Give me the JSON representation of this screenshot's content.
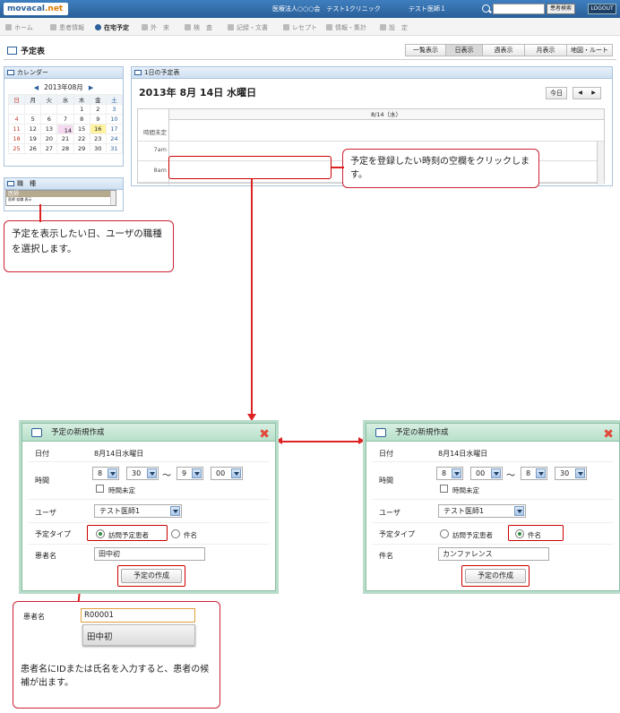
{
  "topbar": {
    "logo_text": "movacal",
    "logo_suffix": ".net",
    "organization": "医療法人○○○会　テスト1クリニック",
    "user": "テスト医師１",
    "search_button": "患者検索",
    "logout": "LOGOUT"
  },
  "nav": {
    "items": [
      {
        "label": "ホーム"
      },
      {
        "label": "患者情報"
      },
      {
        "label": "在宅予定"
      },
      {
        "label": "外　来"
      },
      {
        "label": "検　査"
      },
      {
        "label": "記録・文書"
      },
      {
        "label": "レセプト"
      },
      {
        "label": "情報・集計"
      },
      {
        "label": "設　定"
      }
    ],
    "active_index": 2
  },
  "page": {
    "title": "予定表",
    "view_tabs": [
      "一覧表示",
      "日表示",
      "週表示",
      "月表示",
      "地図・ルート"
    ],
    "active_view": 1
  },
  "calendar": {
    "header": "カレンダー",
    "month": "2013年08月",
    "prev": "◀",
    "next": "▶",
    "weekdays": [
      "日",
      "月",
      "火",
      "水",
      "木",
      "金",
      "土"
    ],
    "rows": [
      [
        "",
        "",
        "",
        "",
        "1",
        "2",
        "3"
      ],
      [
        "4",
        "5",
        "6",
        "7",
        "8",
        "9",
        "10"
      ],
      [
        "11",
        "12",
        "13",
        "14",
        "15",
        "16",
        "17"
      ],
      [
        "18",
        "19",
        "20",
        "21",
        "22",
        "23",
        "24"
      ],
      [
        "25",
        "26",
        "27",
        "28",
        "29",
        "30",
        "31"
      ]
    ],
    "selected_day": "14",
    "today_day": "16"
  },
  "occupation": {
    "header": "職　種",
    "items": [
      "医師",
      "医師 仮職 表示"
    ]
  },
  "day_schedule": {
    "header": "1日の予定表",
    "title": "2013年 8月 14日 水曜日",
    "today_button": "今日",
    "prev": "◀",
    "next": "▶",
    "column_header": "8/14（水）",
    "rows": [
      "時間未定",
      "7am",
      "8am"
    ]
  },
  "callouts": {
    "empty_slot": "予定を登録したい時刻の空欄をクリックします。",
    "select_day": "予定を表示したい日、ユーザの職種を選択します。",
    "autocomplete": "患者名にIDまたは氏名を入力すると、患者の候補が出ます。"
  },
  "dialog_left": {
    "title": "予定の新規作成",
    "date_label": "日付",
    "date_value": "8月14日水曜日",
    "time_label": "時間",
    "start_hour": "8",
    "start_min": "30",
    "tilde": "～",
    "end_hour": "9",
    "end_min": "00",
    "time_undecided": "時間未定",
    "user_label": "ユーザ",
    "user_value": "テスト医師1",
    "type_label": "予定タイプ",
    "type_visit": "訪問予定患者",
    "type_subject": "件名",
    "name_label": "患者名",
    "name_value": "田中初",
    "create_button": "予定の作成"
  },
  "dialog_right": {
    "title": "予定の新規作成",
    "date_label": "日付",
    "date_value": "8月14日水曜日",
    "time_label": "時間",
    "start_hour": "8",
    "start_min": "00",
    "tilde": "～",
    "end_hour": "8",
    "end_min": "30",
    "time_undecided": "時間未定",
    "user_label": "ユーザ",
    "user_value": "テスト医師1",
    "type_label": "予定タイプ",
    "type_visit": "訪問予定患者",
    "type_subject": "件名",
    "name_label": "件名",
    "name_value": "カンファレンス",
    "create_button": "予定の作成"
  },
  "autocomplete": {
    "label": "患者名",
    "input_value": "R00001",
    "suggestion": "田中初"
  },
  "colors": {
    "accent_red": "#cc0000",
    "header_blue": "#2a5f99",
    "dialog_green": "#b7e0ca"
  }
}
